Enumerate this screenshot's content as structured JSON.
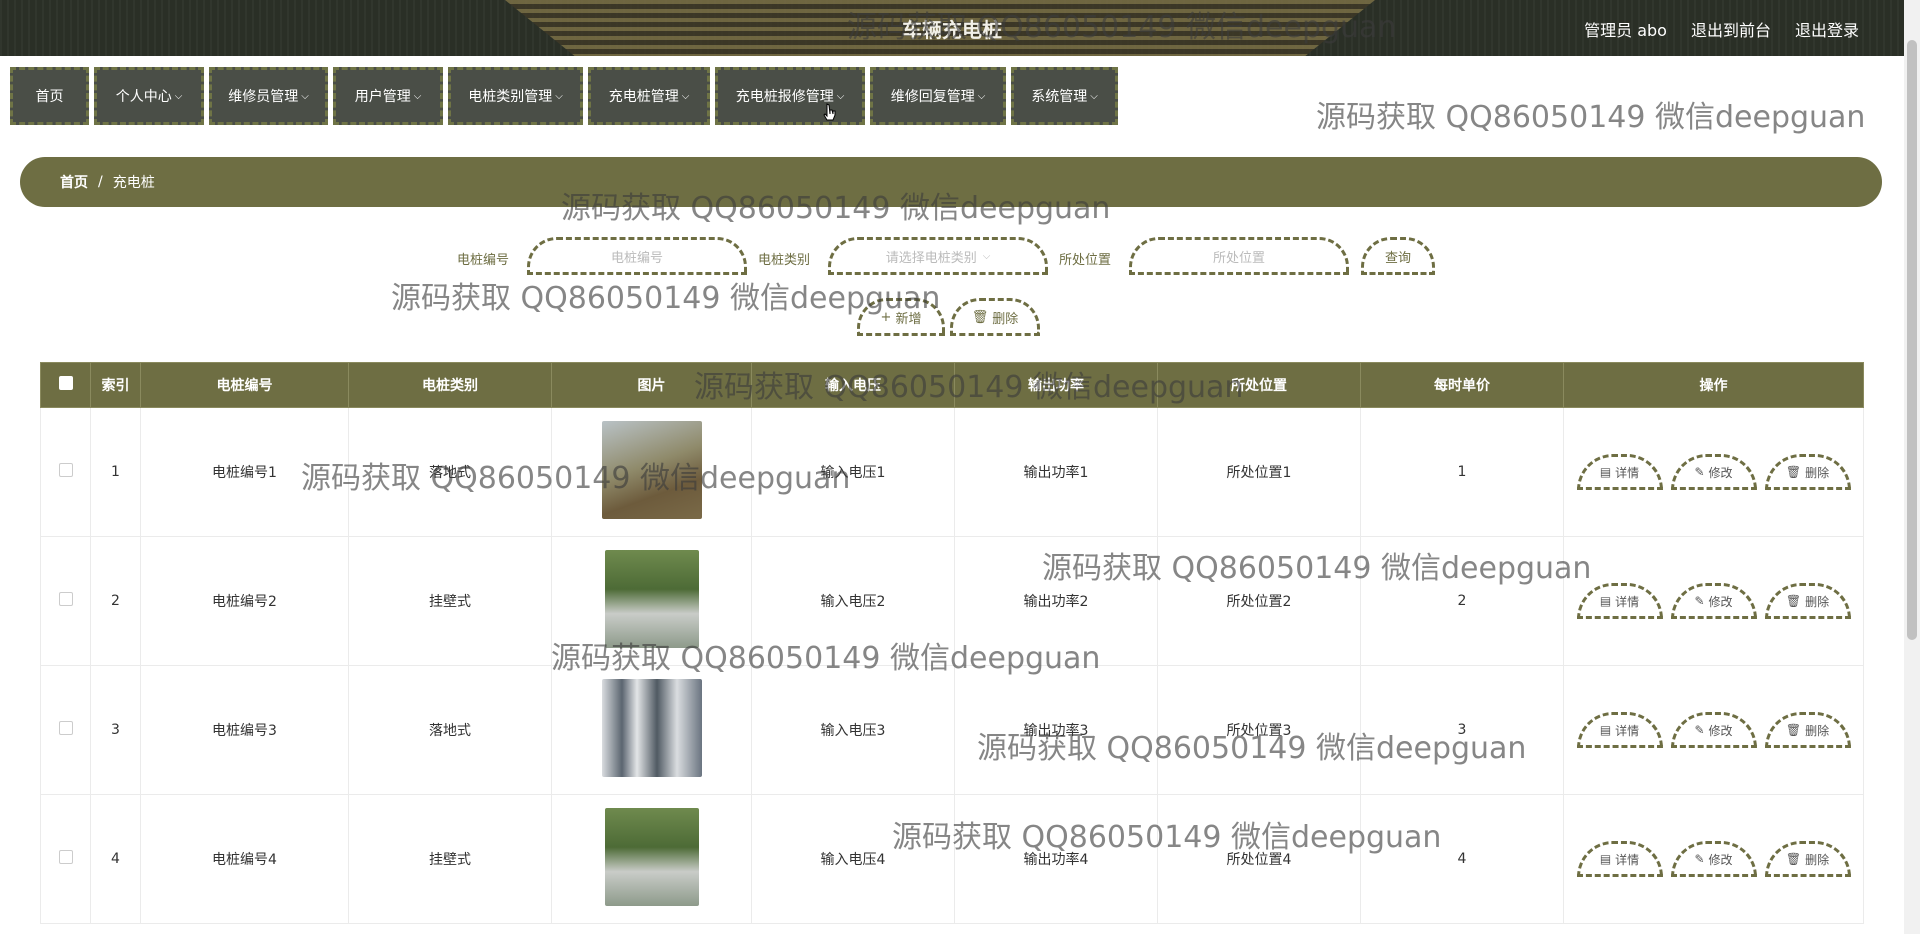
{
  "header": {
    "title": "车辆充电桩",
    "user": "管理员 abo",
    "to_front": "退出到前台",
    "logout": "退出登录"
  },
  "nav": [
    {
      "label": "首页",
      "has_menu": false
    },
    {
      "label": "个人中心",
      "has_menu": true
    },
    {
      "label": "维修员管理",
      "has_menu": true
    },
    {
      "label": "用户管理",
      "has_menu": true
    },
    {
      "label": "电桩类别管理",
      "has_menu": true
    },
    {
      "label": "充电桩管理",
      "has_menu": true
    },
    {
      "label": "充电桩报修管理",
      "has_menu": true
    },
    {
      "label": "维修回复管理",
      "has_menu": true
    },
    {
      "label": "系统管理",
      "has_menu": true
    }
  ],
  "breadcrumb": {
    "home": "首页",
    "separator": "/",
    "current": "充电桩"
  },
  "search": {
    "code_label": "电桩编号",
    "code_placeholder": "电桩编号",
    "type_label": "电桩类别",
    "type_placeholder": "请选择电桩类别",
    "location_label": "所处位置",
    "location_placeholder": "所处位置",
    "query_button": "查询",
    "add_button": "新增",
    "delete_button": "删除"
  },
  "table": {
    "columns": [
      "索引",
      "电桩编号",
      "电桩类别",
      "图片",
      "输入电压",
      "输出功率",
      "所处位置",
      "每时单价",
      "操作"
    ],
    "rows": [
      {
        "index": "1",
        "code": "电桩编号1",
        "type": "落地式",
        "voltage": "输入电压1",
        "power": "输出功率1",
        "location": "所处位置1",
        "price": "1"
      },
      {
        "index": "2",
        "code": "电桩编号2",
        "type": "挂壁式",
        "voltage": "输入电压2",
        "power": "输出功率2",
        "location": "所处位置2",
        "price": "2"
      },
      {
        "index": "3",
        "code": "电桩编号3",
        "type": "落地式",
        "voltage": "输入电压3",
        "power": "输出功率3",
        "location": "所处位置3",
        "price": "3"
      },
      {
        "index": "4",
        "code": "电桩编号4",
        "type": "挂壁式",
        "voltage": "输入电压4",
        "power": "输出功率4",
        "location": "所处位置4",
        "price": "4"
      }
    ],
    "op_detail": "详情",
    "op_edit": "修改",
    "op_delete": "删除"
  },
  "watermark": "源码获取 QQ86050149 微信deepguan",
  "colors": {
    "accent": "#6e6e43",
    "header_bg": "#2a2f26",
    "nav_bg": "#4a4e47"
  }
}
